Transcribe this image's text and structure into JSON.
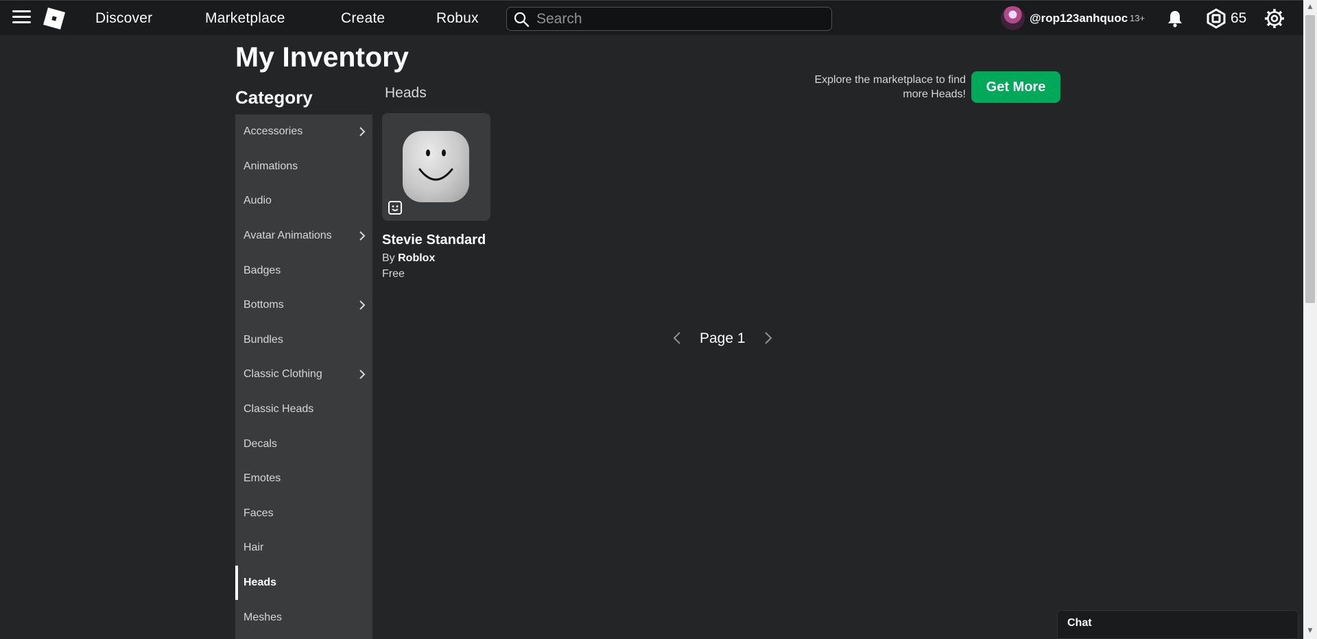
{
  "nav": {
    "links": [
      "Discover",
      "Marketplace",
      "Create",
      "Robux"
    ],
    "search_placeholder": "Search",
    "username": "@rop123anhquoc",
    "age_badge": "13+",
    "robux": "65",
    "icons": [
      "menu-icon",
      "roblox-logo",
      "search-icon",
      "bell-icon",
      "robux-icon",
      "gear-icon"
    ]
  },
  "page": {
    "title": "My Inventory",
    "category_heading": "Category",
    "section_title": "Heads",
    "explore_text": "Explore the marketplace to find more Heads!",
    "get_more_label": "Get More"
  },
  "categories": [
    {
      "label": "Accessories",
      "has_submenu": true
    },
    {
      "label": "Animations",
      "has_submenu": false
    },
    {
      "label": "Audio",
      "has_submenu": false
    },
    {
      "label": "Avatar Animations",
      "has_submenu": true
    },
    {
      "label": "Badges",
      "has_submenu": false
    },
    {
      "label": "Bottoms",
      "has_submenu": true
    },
    {
      "label": "Bundles",
      "has_submenu": false
    },
    {
      "label": "Classic Clothing",
      "has_submenu": true
    },
    {
      "label": "Classic Heads",
      "has_submenu": false
    },
    {
      "label": "Decals",
      "has_submenu": false
    },
    {
      "label": "Emotes",
      "has_submenu": false
    },
    {
      "label": "Faces",
      "has_submenu": false
    },
    {
      "label": "Hair",
      "has_submenu": false
    },
    {
      "label": "Heads",
      "has_submenu": false,
      "active": true
    },
    {
      "label": "Meshes",
      "has_submenu": false
    }
  ],
  "items": [
    {
      "name": "Stevie Standard",
      "creator_prefix": "By",
      "creator": "Roblox",
      "price": "Free"
    }
  ],
  "pager": {
    "label": "Page 1"
  },
  "chat": {
    "label": "Chat"
  },
  "colors": {
    "accent_green": "#00a85a",
    "background": "#232527",
    "topbar": "#191b1d",
    "sidebar": "#393b3d"
  }
}
